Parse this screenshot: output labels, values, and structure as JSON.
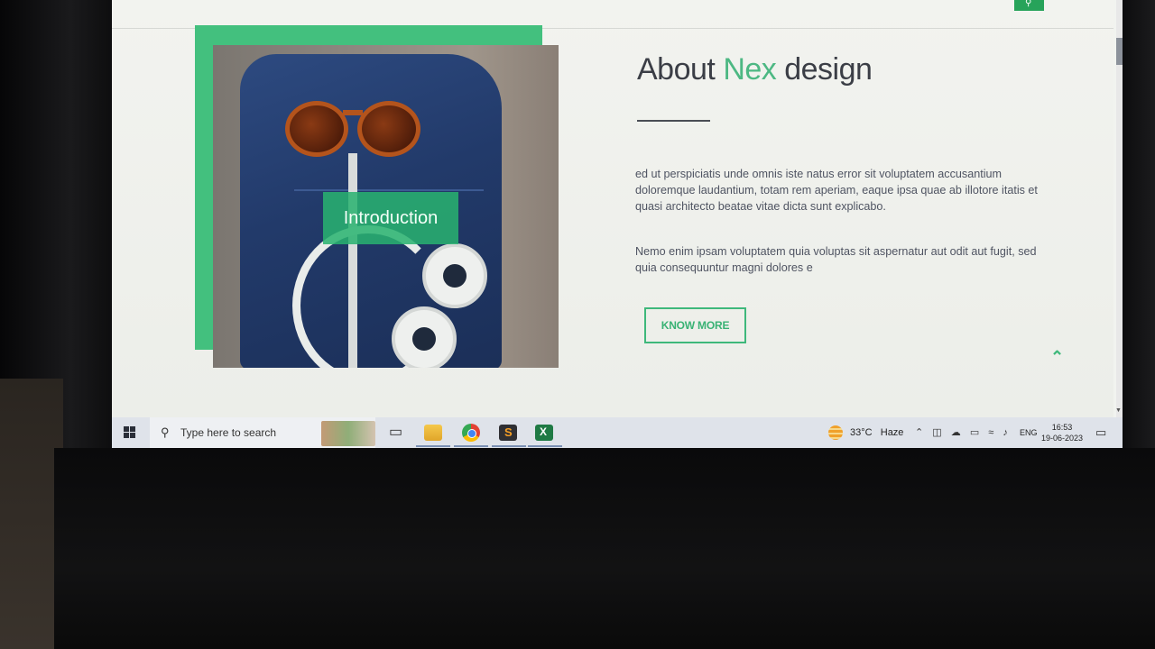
{
  "website": {
    "about_title_pre": "About",
    "about_title_accent": "Nex",
    "about_title_post": "design",
    "paragraph_1": "ed ut perspiciatis unde omnis iste natus error sit voluptatem accusantium doloremque laudantium, totam rem aperiam, eaque ipsa quae ab illotore itatis et quasi architecto beatae vitae dicta sunt explicabo.",
    "paragraph_2": "Nemo enim ipsam voluptatem quia voluptas sit aspernatur aut odit aut fugit, sed quia consequuntur magni dolores e",
    "intro_badge": "Introduction",
    "know_more_button": "KNOW MORE",
    "back_to_top_icon": "chevron-up-icon",
    "accent_color": "#43c07e"
  },
  "taskbar": {
    "search_placeholder": "Type here to search",
    "apps": [
      "task-view-icon",
      "file-explorer-icon",
      "chrome-icon",
      "sublime-text-icon",
      "excel-icon"
    ],
    "weather_temp": "33°C",
    "weather_desc": "Haze",
    "language": "ENG",
    "time": "16:53",
    "date": "19-06-2023"
  }
}
